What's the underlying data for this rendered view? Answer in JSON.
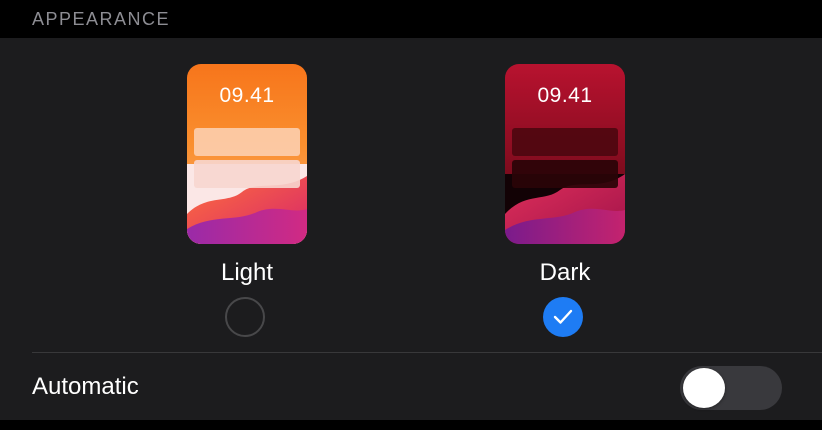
{
  "section": {
    "header": "APPEARANCE"
  },
  "options": {
    "light": {
      "label": "Light",
      "time": "09.41",
      "selected": false
    },
    "dark": {
      "label": "Dark",
      "time": "09.41",
      "selected": true
    }
  },
  "automatic": {
    "label": "Automatic",
    "enabled": false
  },
  "colors": {
    "accent": "#1e7cf4",
    "card_background": "#1c1c1e",
    "toggle_off": "#39393d"
  },
  "icons": {
    "selected_radio": "checkmark-icon"
  }
}
